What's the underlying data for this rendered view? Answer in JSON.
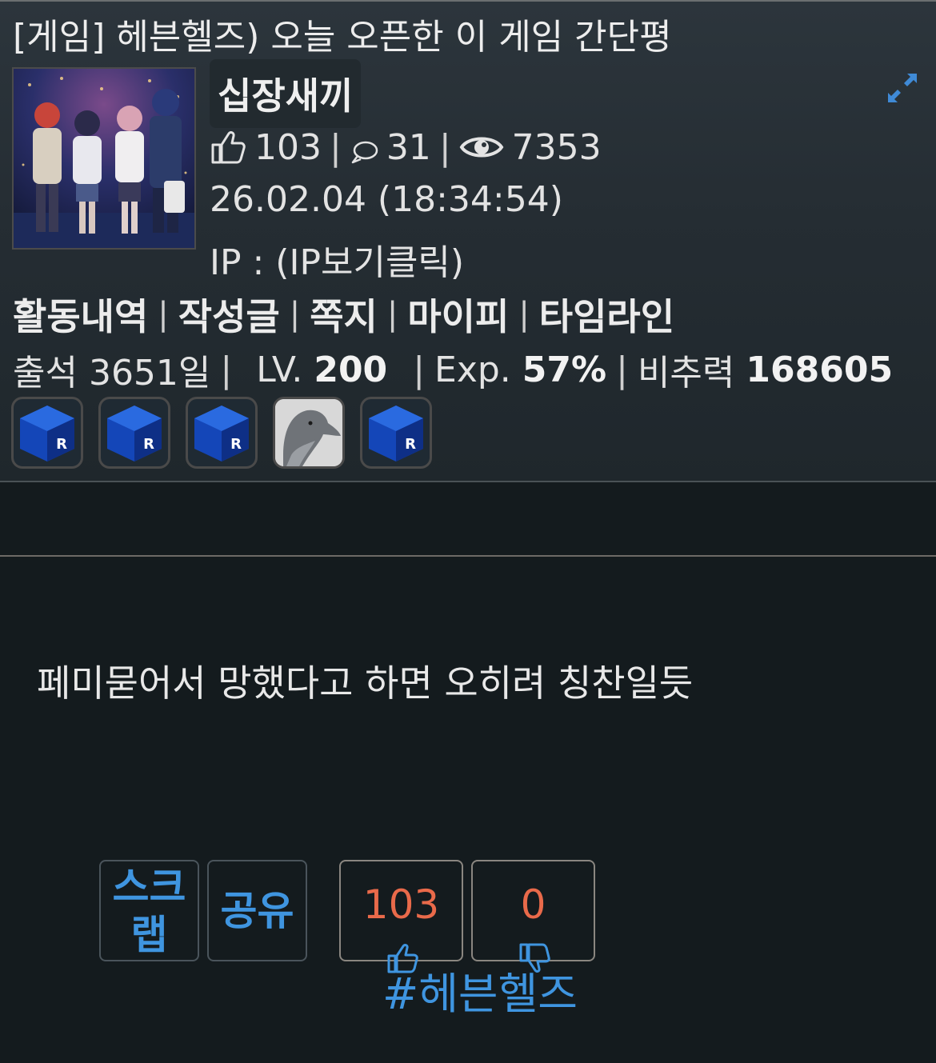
{
  "post": {
    "title": "[게임] 헤븐헬즈) 오늘 오픈한 이 게임 간단평"
  },
  "author": {
    "nickname": "십장새끼",
    "likes": "103",
    "comments": "31",
    "views": "7353",
    "datetime": "26.02.04 (18:34:54)",
    "ip_label": "IP : (IP보기클릭)"
  },
  "menu": {
    "items": [
      "활동내역",
      "작성글",
      "쪽지",
      "마이피",
      "타임라인"
    ]
  },
  "stats": {
    "attendance_label": "출석 3651일",
    "lv_label": "LV.",
    "lv_value": "200",
    "exp_label": "Exp.",
    "exp_value": "57%",
    "recommend_label": "비추력",
    "recommend_value": "168605"
  },
  "badges": [
    {
      "icon": "blue-r-cube-icon"
    },
    {
      "icon": "blue-r-cube-icon"
    },
    {
      "icon": "blue-r-cube-icon"
    },
    {
      "icon": "dolphin-icon"
    },
    {
      "icon": "blue-r-cube-icon"
    }
  ],
  "content": {
    "text": "페미묻어서 망했다고 하면 오히려 칭찬일듯"
  },
  "actions": {
    "scrap_line1": "스크",
    "scrap_line2": "랩",
    "share_label": "공유",
    "upvote_count": "103",
    "downvote_count": "0"
  },
  "tag": "#헤븐헬즈",
  "colors": {
    "accent_blue": "#3f95e0",
    "vote_count": "#e96a4a",
    "background": "#141b1e"
  }
}
